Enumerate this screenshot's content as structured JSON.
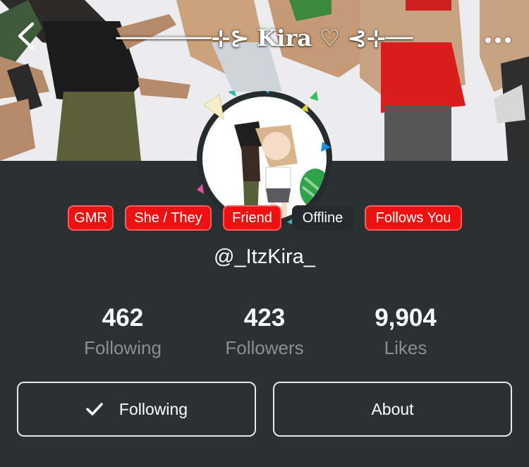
{
  "header": {
    "title": "───────⊹⊱ Kira ♡ ⊰⊹──",
    "back_icon": "chevron-left-icon",
    "more_icon": "more-horizontal-icon"
  },
  "tags": [
    {
      "label": "GMR",
      "color": "#ee1111"
    },
    {
      "label": "She / They",
      "color": "#ee1111"
    },
    {
      "label": "Friend",
      "color": "#ee1111"
    },
    {
      "label": "Offline",
      "color": "#262a2c"
    },
    {
      "label": "Follows You",
      "color": "#ee1111"
    }
  ],
  "profile": {
    "handle": "@_ItzKira_"
  },
  "stats": [
    {
      "value": "462",
      "label": "Following"
    },
    {
      "value": "423",
      "label": "Followers"
    },
    {
      "value": "9,904",
      "label": "Likes"
    }
  ],
  "actions": {
    "following_label": "Following",
    "following_icon": "checkmark-icon",
    "about_label": "About"
  },
  "colors": {
    "background": "#2b3032",
    "tag_red": "#ee1111",
    "stat_label": "#8a8f92"
  }
}
